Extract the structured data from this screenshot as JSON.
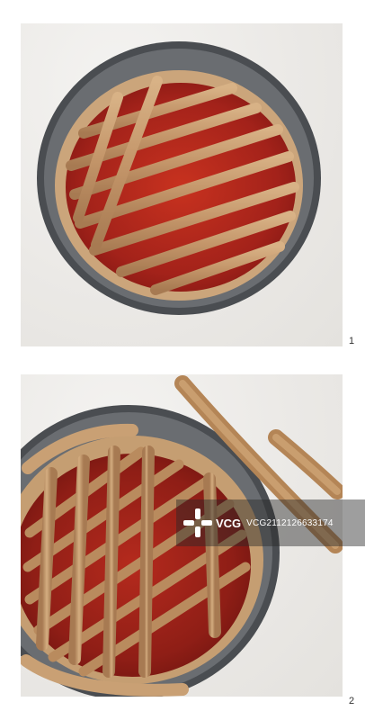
{
  "steps": [
    {
      "number": "1"
    },
    {
      "number": "2"
    }
  ],
  "watermark": {
    "brand": "VCG",
    "id": "VCG2112126633174"
  },
  "colors": {
    "marble": "#ece9e5",
    "pan_rim": "#5d6064",
    "crust": "#c9a57c",
    "jam": "#a8231a",
    "dough_strip": "#c79a6b"
  }
}
